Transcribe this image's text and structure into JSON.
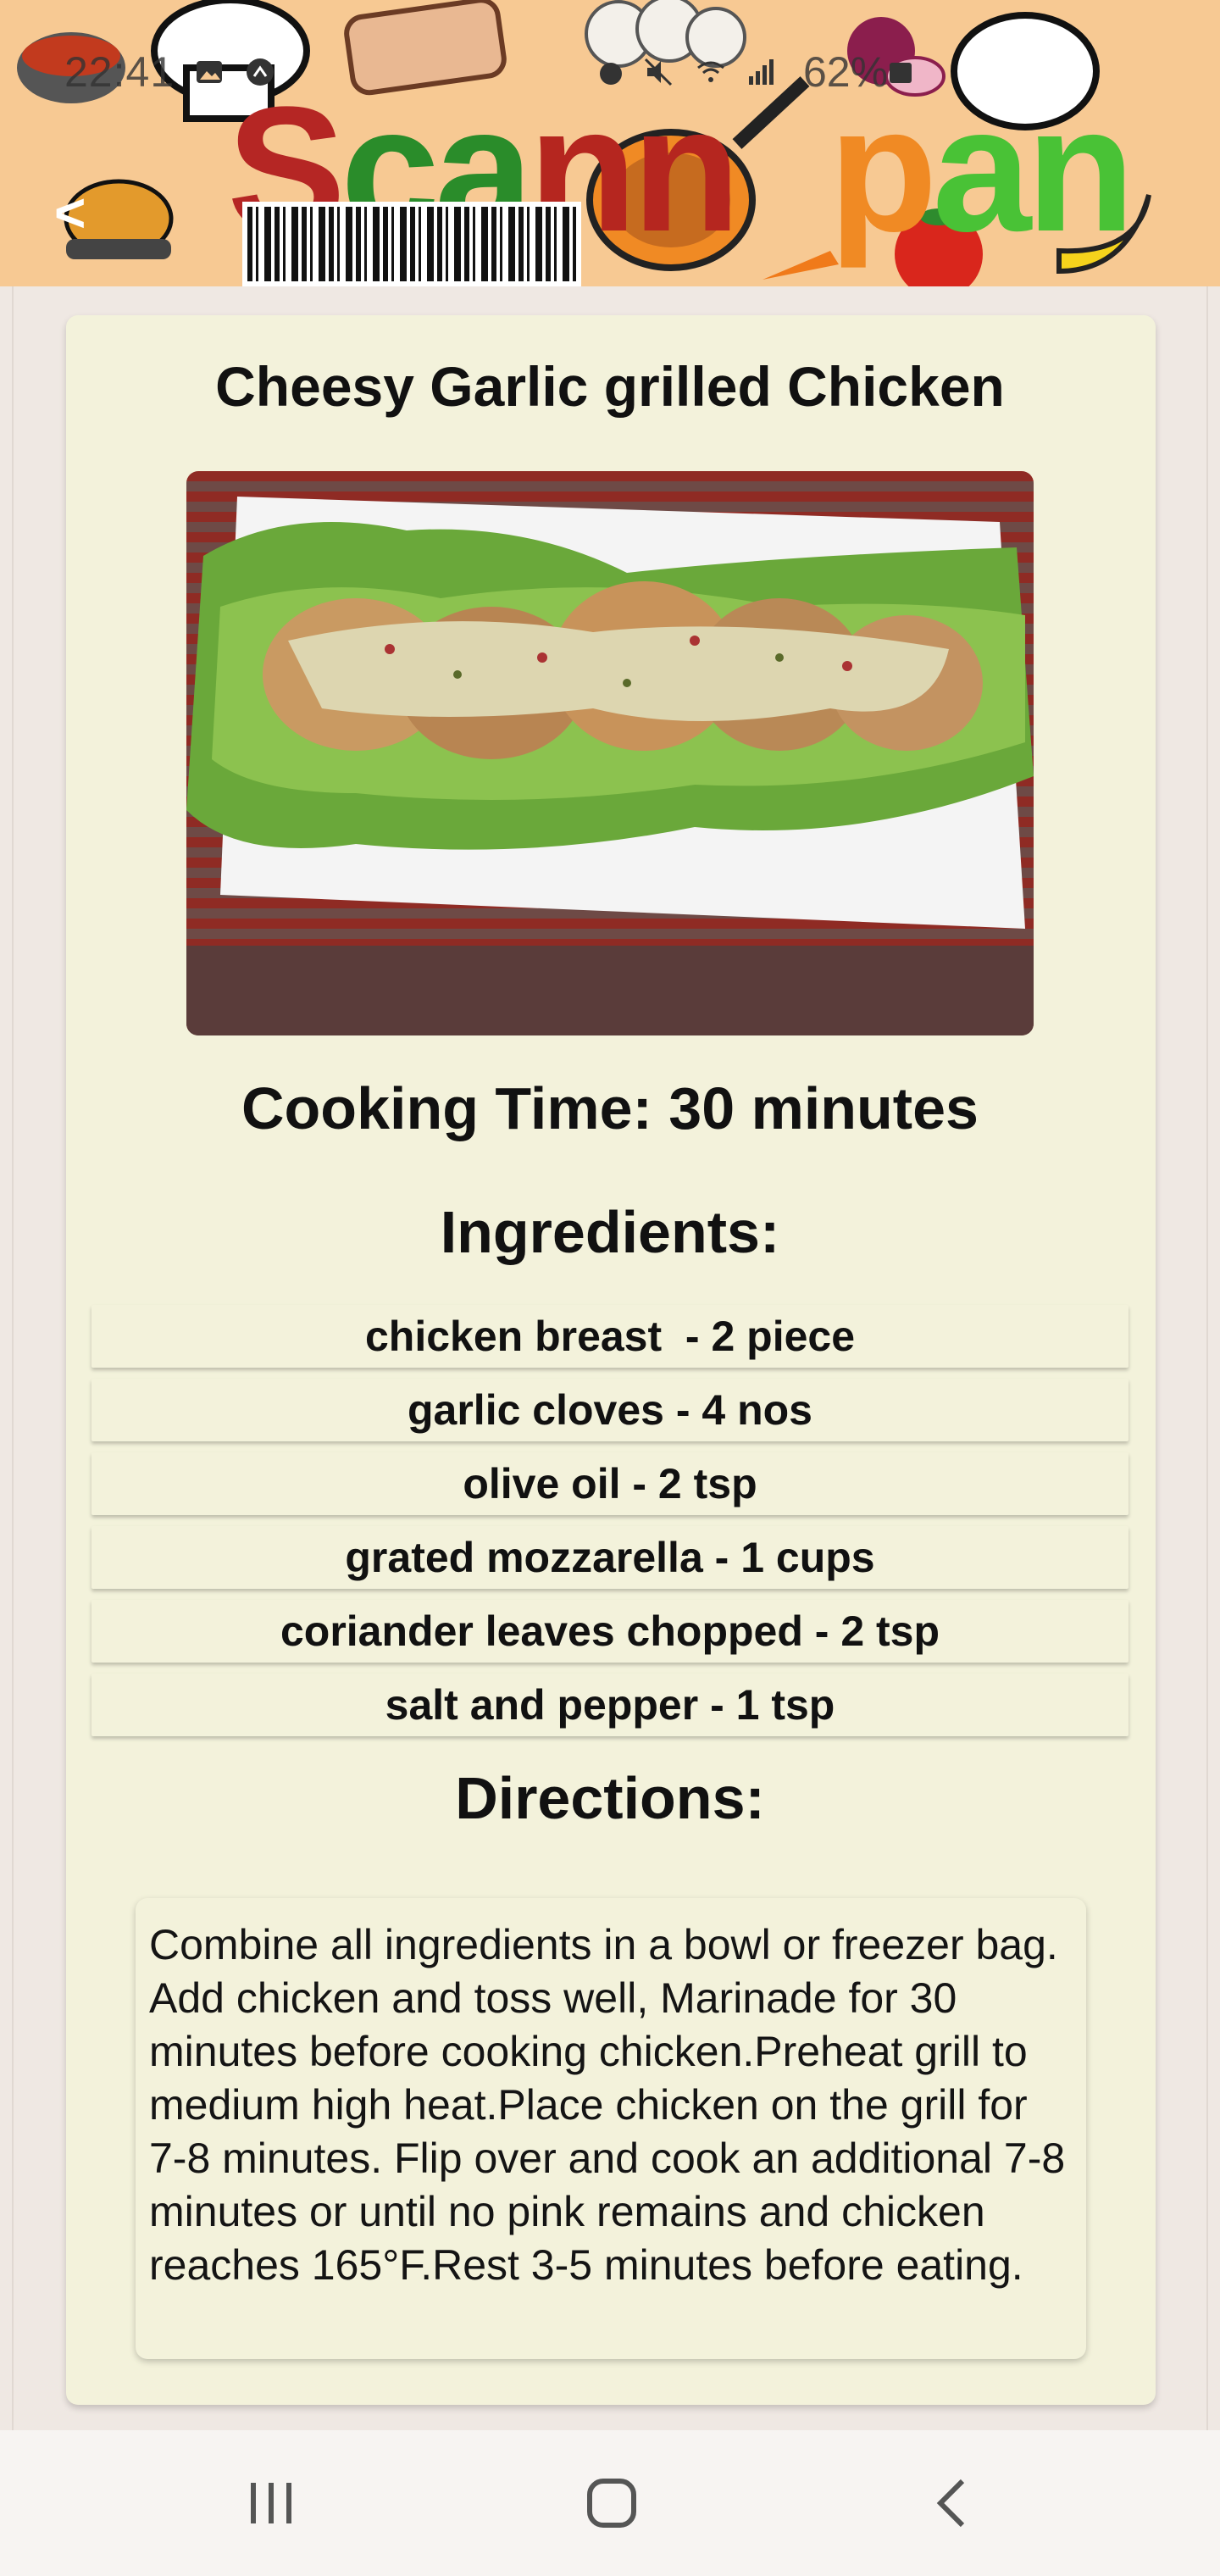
{
  "status_bar": {
    "time": "22:41",
    "battery": "62%"
  },
  "header": {
    "logo_text": "Scannpan",
    "logo_parts": [
      "S",
      "ca",
      "nn",
      "p",
      "an"
    ],
    "back_label": "<"
  },
  "recipe": {
    "title": "Cheesy Garlic grilled Chicken",
    "cooking_time": "Cooking Time: 30 minutes",
    "ingredients_heading": "Ingredients:",
    "ingredients": [
      "chicken breast  - 2 piece",
      "garlic cloves - 4 nos",
      "olive oil - 2 tsp",
      "grated mozzarella - 1 cups",
      "coriander leaves chopped - 2 tsp",
      "salt and pepper - 1 tsp"
    ],
    "directions_heading": "Directions:",
    "directions": "Combine all ingredients in a bowl or freezer bag. Add chicken and toss well, Marinade for 30 minutes before cooking chicken.Preheat grill to medium high heat.Place chicken on the grill for 7-8 minutes. Flip over and cook an additional 7-8 minutes or until no pink remains and chicken reaches 165°F.Rest 3-5 minutes before eating."
  },
  "nav": {
    "recents_icon": "recent-apps-icon",
    "home_icon": "home-icon",
    "back_icon": "back-icon"
  },
  "colors": {
    "banner": "#f7c993",
    "card": "#f3f2db",
    "page": "#efe8e3"
  }
}
